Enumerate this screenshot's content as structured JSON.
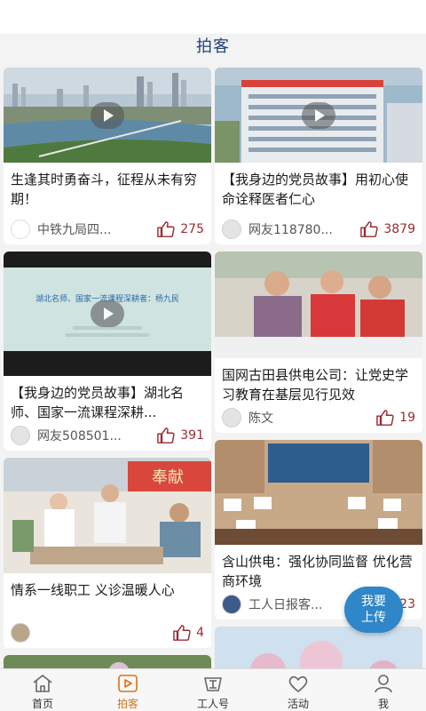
{
  "header": {
    "title": "拍客"
  },
  "fab": {
    "line1": "我要",
    "line2": "上传"
  },
  "feed": {
    "left": [
      {
        "title": "生逢其时勇奋斗，征程从未有穷期！",
        "author": "中铁九局四...",
        "likes": "275",
        "video": true
      },
      {
        "title": "【我身边的党员故事】湖北名师、国家一流课程深耕...",
        "author": "网友508501...",
        "likes": "391",
        "video": true
      },
      {
        "title": "情系一线职工 义诊温暖人心",
        "author": "",
        "likes": "4",
        "video": false
      }
    ],
    "right": [
      {
        "title": "【我身边的党员故事】用初心使命诠释医者仁心",
        "author": "网友118780...",
        "likes": "3879",
        "video": true
      },
      {
        "title": "国网古田县供电公司：让党史学习教育在基层见行见效",
        "author": "陈文",
        "likes": "19",
        "video": false
      },
      {
        "title": "含山供电：强化协同监督 优化营商环境",
        "author": "工人日报客...",
        "likes": "323",
        "video": false
      }
    ]
  },
  "thumb_text": {
    "slide_text": "湖北名师、国家一流课程深耕者：杨九民",
    "banner_text": "奉献"
  },
  "tabs": [
    {
      "label": "首页",
      "icon": "home-icon",
      "active": false
    },
    {
      "label": "拍客",
      "icon": "video-icon",
      "active": true
    },
    {
      "label": "工人号",
      "icon": "worker-badge-icon",
      "active": false
    },
    {
      "label": "活动",
      "icon": "heart-icon",
      "active": false
    },
    {
      "label": "我",
      "icon": "person-icon",
      "active": false
    }
  ],
  "colors": {
    "accent": "#d9731b",
    "title": "#233f7a",
    "likes": "#9a2b32",
    "fab": "#2f86c8"
  }
}
